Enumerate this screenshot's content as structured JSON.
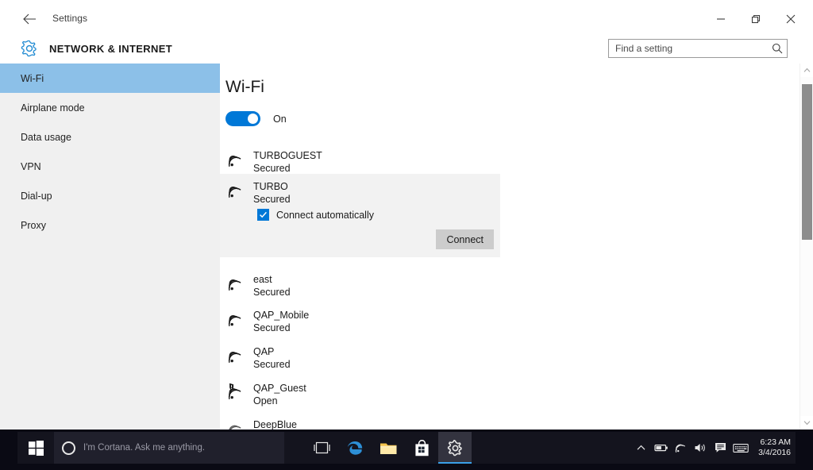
{
  "window": {
    "title": "Settings",
    "back_icon": "back-arrow-icon",
    "minimize_icon": "minimize-icon",
    "maximize_icon": "restore-icon",
    "close_icon": "close-icon"
  },
  "header": {
    "gear_icon": "gear-icon",
    "category": "NETWORK & INTERNET",
    "accent_color": "#0078d7"
  },
  "search": {
    "placeholder": "Find a setting",
    "value": "",
    "icon": "search-icon"
  },
  "sidebar": {
    "selected_color": "#8cc0e8",
    "items": [
      {
        "label": "Wi-Fi",
        "selected": true
      },
      {
        "label": "Airplane mode",
        "selected": false
      },
      {
        "label": "Data usage",
        "selected": false
      },
      {
        "label": "VPN",
        "selected": false
      },
      {
        "label": "Dial-up",
        "selected": false
      },
      {
        "label": "Proxy",
        "selected": false
      }
    ]
  },
  "main": {
    "heading": "Wi-Fi",
    "toggle": {
      "label": "On",
      "state": "on",
      "color": "#0078d7"
    },
    "networks": [
      {
        "ssid": "TURBOGUEST",
        "status": "Secured",
        "icon": "wifi-signal-icon",
        "expanded": false
      },
      {
        "ssid": "east",
        "status": "Secured",
        "icon": "wifi-signal-icon",
        "expanded": false
      },
      {
        "ssid": "QAP_Mobile",
        "status": "Secured",
        "icon": "wifi-signal-icon",
        "expanded": false
      },
      {
        "ssid": "QAP",
        "status": "Secured",
        "icon": "wifi-signal-icon",
        "expanded": false
      },
      {
        "ssid": "QAP_Guest",
        "status": "Open",
        "icon": "wifi-signal-warning-icon",
        "expanded": false
      },
      {
        "ssid": "DeepBlue",
        "status": "",
        "icon": "wifi-signal-icon",
        "expanded": false
      }
    ],
    "selected_network": {
      "ssid": "TURBO",
      "status": "Secured",
      "icon": "wifi-signal-icon",
      "checkbox_label": "Connect automatically",
      "checkbox_checked": true,
      "connect_label": "Connect"
    }
  },
  "scrollbar": {
    "up_arrow": "chevron-up-icon",
    "down_arrow": "chevron-down-icon"
  },
  "taskbar": {
    "start_icon": "windows-start-icon",
    "cortana": {
      "placeholder": "I'm Cortana. Ask me anything.",
      "icon": "cortana-circle-icon"
    },
    "pinned": [
      {
        "name": "task-view-icon",
        "label": "Task View",
        "active": false
      },
      {
        "name": "edge-icon",
        "label": "Microsoft Edge",
        "active": false
      },
      {
        "name": "file-explorer-icon",
        "label": "File Explorer",
        "active": false
      },
      {
        "name": "store-icon",
        "label": "Store",
        "active": false
      },
      {
        "name": "settings-icon",
        "label": "Settings",
        "active": true
      }
    ],
    "tray": [
      {
        "name": "show-hidden-icons-icon"
      },
      {
        "name": "battery-icon"
      },
      {
        "name": "wifi-tray-icon"
      },
      {
        "name": "volume-icon"
      },
      {
        "name": "action-center-icon"
      },
      {
        "name": "touch-keyboard-icon"
      }
    ],
    "clock": {
      "time": "6:23 AM",
      "date": "3/4/2016"
    }
  }
}
